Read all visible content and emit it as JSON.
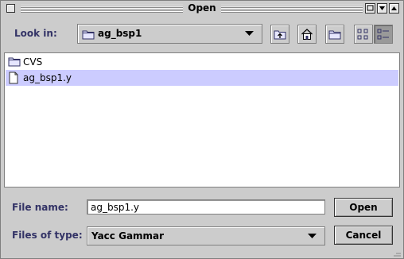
{
  "window": {
    "title": "Open",
    "title_buttons": [
      "minimize-icon",
      "maximize-icon",
      "close-icon"
    ]
  },
  "toolbar": {
    "look_in_label": "Look in:",
    "look_in_mnemonic": "i",
    "current_folder": "ag_bsp1",
    "buttons": [
      {
        "name": "up-one-level",
        "icon": "folder-up-icon"
      },
      {
        "name": "home",
        "icon": "home-icon"
      },
      {
        "name": "create-new-folder",
        "icon": "new-folder-icon"
      },
      {
        "name": "list-view",
        "icon": "list-view-icon",
        "pressed": false
      },
      {
        "name": "details-view",
        "icon": "details-view-icon",
        "pressed": true
      }
    ]
  },
  "files": [
    {
      "name": "CVS",
      "type": "folder",
      "icon": "folder-icon",
      "selected": false
    },
    {
      "name": "ag_bsp1.y",
      "type": "file",
      "icon": "file-icon",
      "selected": true
    }
  ],
  "file_name": {
    "label": "File name:",
    "value": "ag_bsp1.y"
  },
  "file_type": {
    "label": "Files of type:",
    "value": "Yacc Gammar"
  },
  "buttons": {
    "open": "Open",
    "cancel": "Cancel"
  },
  "colors": {
    "background": "#cccccc",
    "selection": "#ccccff",
    "label": "#333366"
  }
}
